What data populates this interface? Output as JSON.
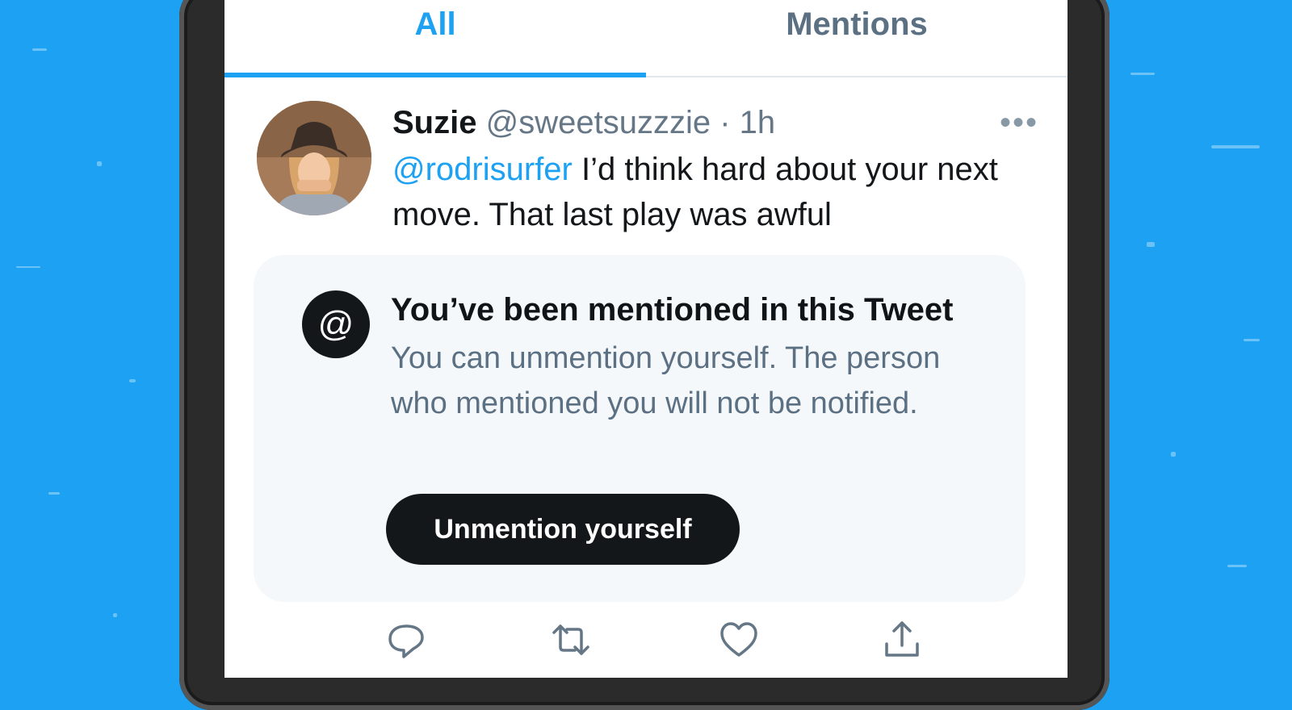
{
  "tabs": [
    {
      "label": "All",
      "active": true
    },
    {
      "label": "Mentions",
      "active": false
    }
  ],
  "tweet": {
    "author_name": "Suzie",
    "author_handle": "@sweetsuzzzie",
    "separator": "·",
    "time": "1h",
    "more_label": "•••",
    "mention": "@rodrisurfer",
    "text": " I’d think hard about your next move. That last play was awful"
  },
  "notice": {
    "icon_symbol": "@",
    "title": "You’ve been mentioned in this Tweet",
    "body": "You can unmention yourself. The person who mentioned you will not be notified.",
    "button_label": "Unmention yourself"
  },
  "actions": [
    "reply-icon",
    "retweet-icon",
    "like-icon",
    "share-icon"
  ],
  "colors": {
    "accent": "#1da1f2",
    "text_primary": "#14171a",
    "text_secondary": "#5b7083",
    "card_bg": "#f5f8fa",
    "button_bg": "#14171a"
  }
}
